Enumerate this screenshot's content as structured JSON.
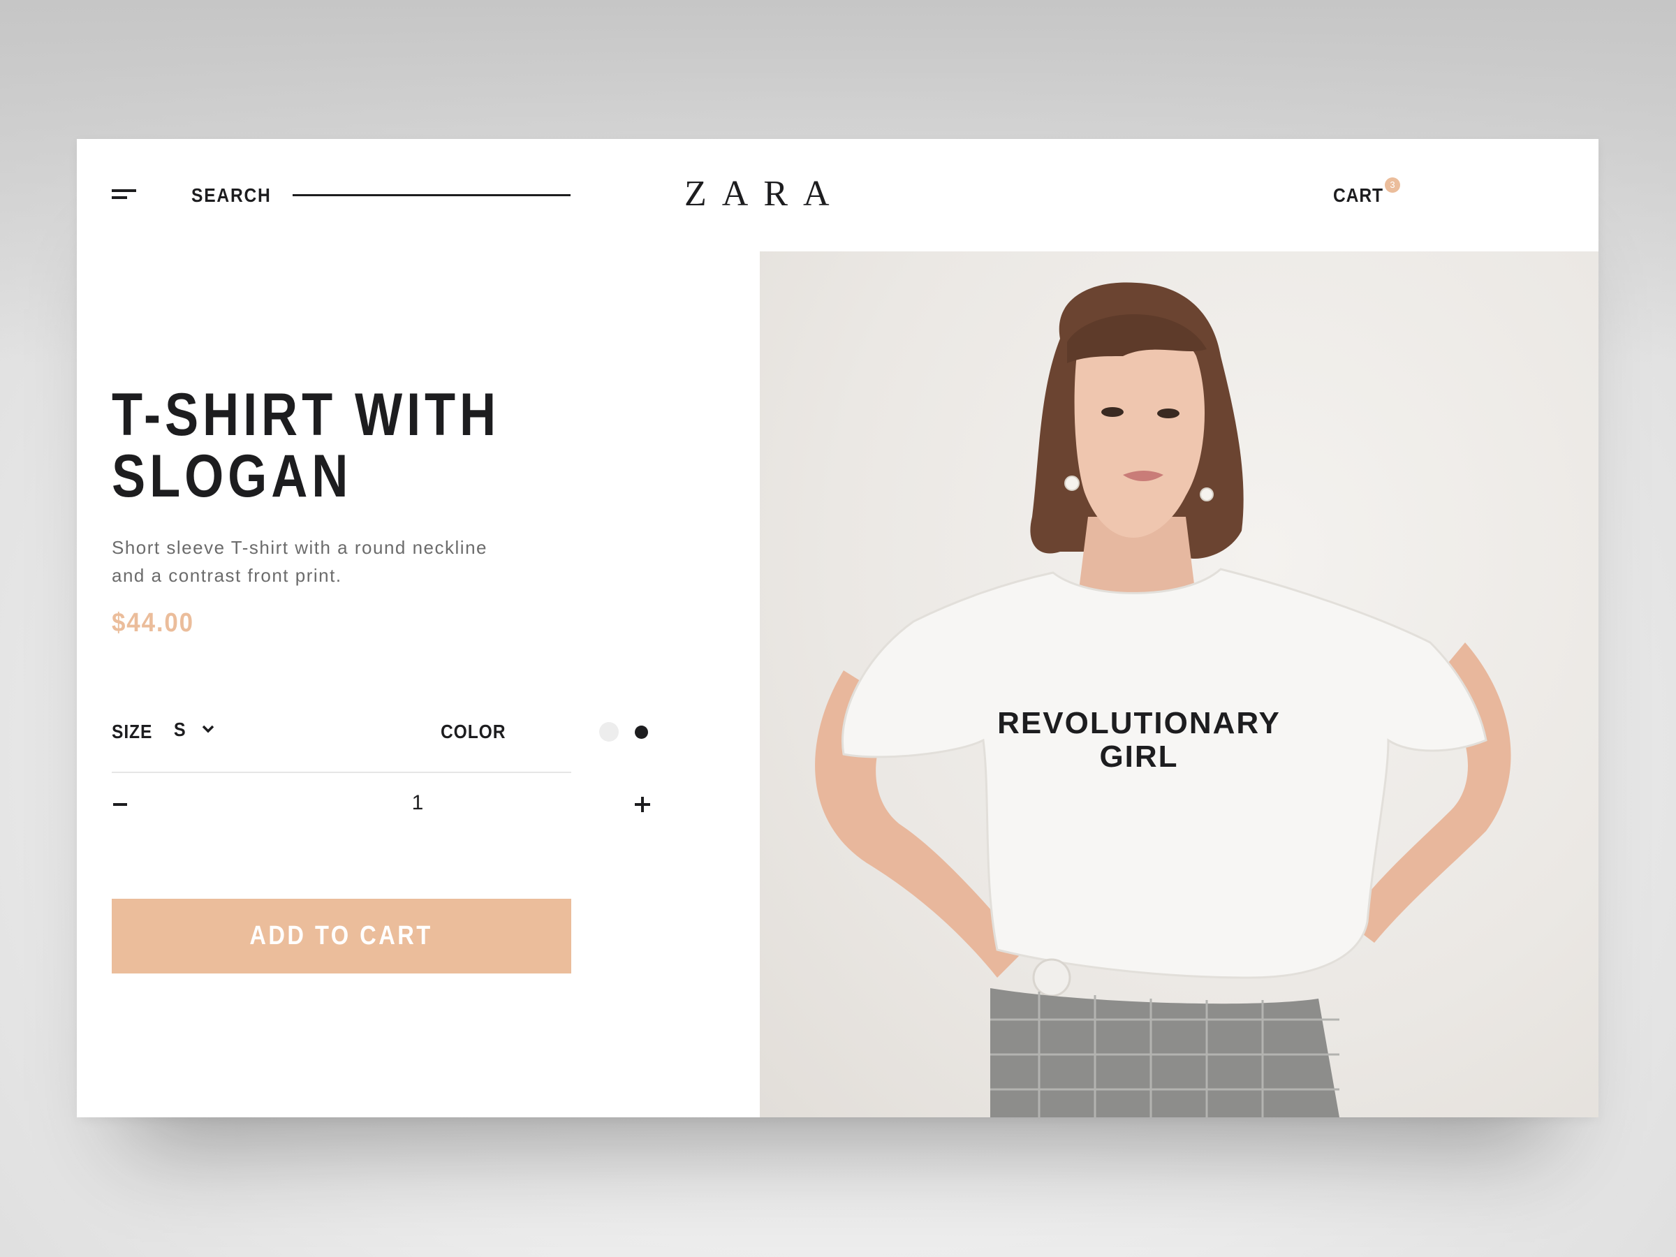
{
  "header": {
    "search_label": "SEARCH",
    "search_value": "",
    "logo_text": "ZARA",
    "cart_label": "CART",
    "cart_count": "3"
  },
  "product": {
    "title_lines": [
      "T-SHIRT WITH",
      "SLOGAN"
    ],
    "description": "Short sleeve T-shirt with a round neckline and a contrast front print.",
    "price": "$44.00",
    "size_label": "SIZE",
    "size_value": "S",
    "color_label": "COLOR",
    "colors": [
      "#ededed",
      "#1d1d1f"
    ],
    "quantity": "1",
    "add_to_cart_label": "ADD TO CART"
  },
  "photo": {
    "shirt_print": [
      "REVOLUTIONARY",
      "GIRL"
    ]
  },
  "theme": {
    "accent": "#ebbd9b",
    "text": "#1d1d1f",
    "muted_text": "#6b6b6b"
  },
  "icons": [
    "menu-icon",
    "chevron-down-icon",
    "minus-icon",
    "plus-icon"
  ]
}
